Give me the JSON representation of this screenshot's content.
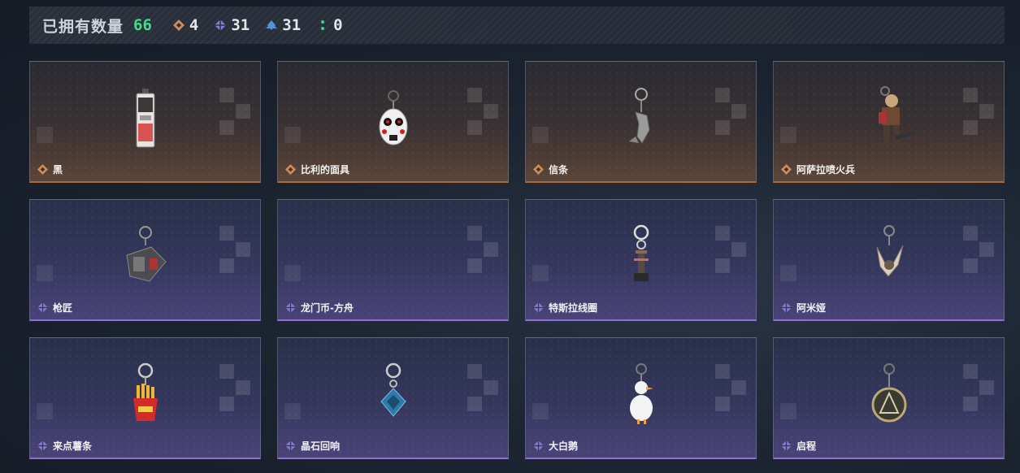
{
  "header": {
    "owned_label": "已拥有数量",
    "owned_count": "66",
    "stats": [
      {
        "icon": "orange-diamond-icon",
        "color": "#d38a55",
        "value": "4"
      },
      {
        "icon": "purple-diamond-icon",
        "color": "#8e7ad6",
        "value": "31"
      },
      {
        "icon": "blue-diamond-icon",
        "color": "#5b8fd6",
        "value": "31"
      },
      {
        "icon": "green-dots-icon",
        "color": "#3fd08a",
        "value": "0"
      }
    ]
  },
  "colors": {
    "orange": "#d38a55",
    "purple": "#8e7ad6",
    "accent_green": "#3fe08a"
  },
  "items": [
    {
      "name": "黑",
      "tier": "orange"
    },
    {
      "name": "比利的面具",
      "tier": "orange"
    },
    {
      "name": "信条",
      "tier": "orange"
    },
    {
      "name": "阿萨拉喷火兵",
      "tier": "orange"
    },
    {
      "name": "枪匠",
      "tier": "purple"
    },
    {
      "name": "龙门币-方舟",
      "tier": "purple"
    },
    {
      "name": "特斯拉线圈",
      "tier": "purple"
    },
    {
      "name": "阿米娅",
      "tier": "purple"
    },
    {
      "name": "来点薯条",
      "tier": "purple"
    },
    {
      "name": "晶石回响",
      "tier": "purple"
    },
    {
      "name": "大白鹅",
      "tier": "purple"
    },
    {
      "name": "启程",
      "tier": "purple"
    }
  ]
}
